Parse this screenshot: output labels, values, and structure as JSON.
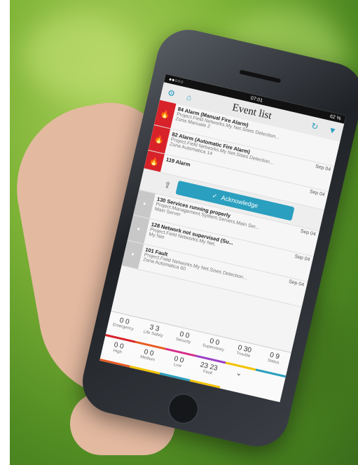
{
  "status": {
    "carrier": "●●○○○",
    "time": "07:01",
    "battery": "62 %"
  },
  "app": {
    "title": "Event list"
  },
  "events": [
    {
      "id": "84",
      "title": "Alarm (Manual Fire Alarm)",
      "path": "Project.Field Networks.My Net.Sises Detection...",
      "zone": "Zona Manuale 2",
      "date": "",
      "type": "fire"
    },
    {
      "id": "82",
      "title": "Alarm (Automatic Fire Alarm)",
      "path": "Project.Field Networks.My Net.Sises Detection...",
      "zone": "Zona Automatica 14",
      "date": "Sep 04",
      "type": "fire"
    },
    {
      "id": "119",
      "title": "Alarm",
      "path": "",
      "zone": "",
      "date": "Sep 04",
      "type": "fire"
    }
  ],
  "acknowledge_label": "Acknowledge",
  "events2": [
    {
      "id": "130",
      "title": "Services running properly",
      "path": "Project.Management System.Servers.Main Ser...",
      "zone": "Main Server",
      "date": "Sep 04",
      "type": "info"
    },
    {
      "id": "128",
      "title": "Network not supervised (Su...",
      "path": "Project.Field Networks.My Net.",
      "zone": "My Net",
      "date": "Sep 04",
      "type": "info"
    },
    {
      "id": "101",
      "title": "Fault",
      "path": "Project.Field Networks.My Net.Sises Detection...",
      "zone": "Zona Automatica 60",
      "date": "Sep 04",
      "type": "info"
    }
  ],
  "summary": [
    {
      "label": "Emergency",
      "a": "0",
      "b": "0",
      "color": "#d8222a"
    },
    {
      "label": "Life Safety",
      "a": "3",
      "b": "3",
      "color": "#e85a1f"
    },
    {
      "label": "Security",
      "a": "0",
      "b": "0",
      "color": "#d62e8a"
    },
    {
      "label": "Supervisory",
      "a": "0",
      "b": "0",
      "color": "#9b3fc5"
    },
    {
      "label": "Trouble",
      "a": "0",
      "b": "30",
      "color": "#f2c200"
    },
    {
      "label": "Status",
      "a": "0",
      "b": "9",
      "color": "#2a9fbf"
    }
  ],
  "summary2": [
    {
      "label": "High",
      "value": "0 0"
    },
    {
      "label": "Medium",
      "value": "0 0"
    },
    {
      "label": "Low",
      "value": "0 0"
    },
    {
      "label": "Fault",
      "value": "23 23"
    }
  ]
}
